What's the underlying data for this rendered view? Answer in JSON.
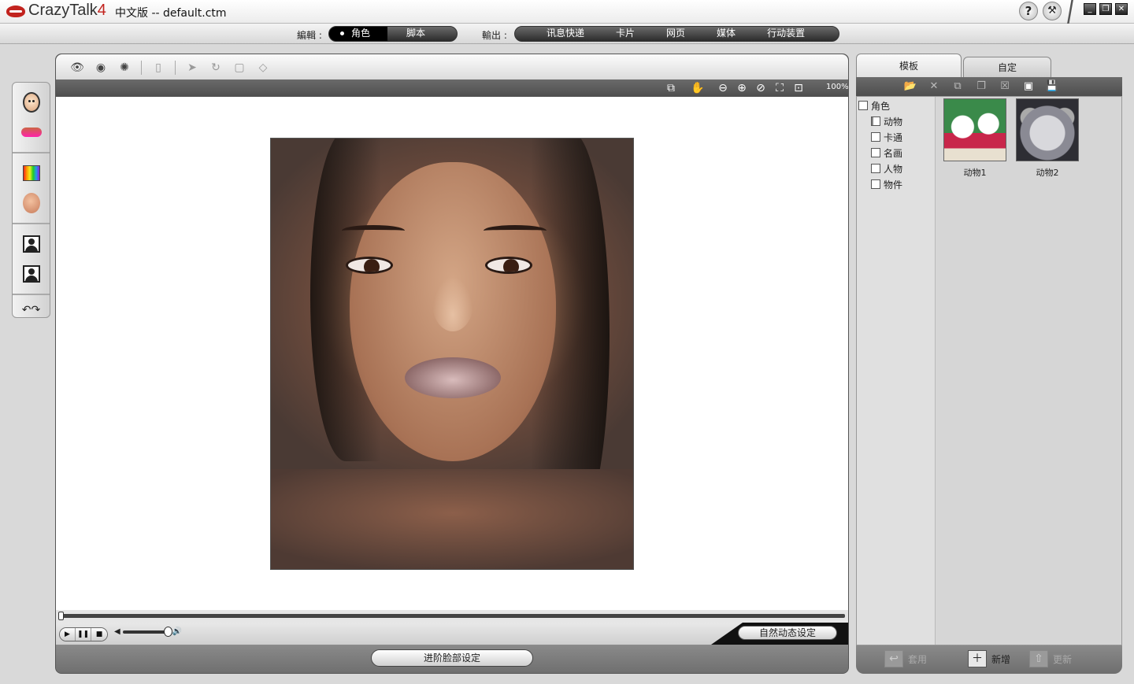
{
  "titlebar": {
    "brand": "CrazyTalk",
    "brand_version": "4",
    "subtitle": "中文版 -- default.ctm",
    "help_icon": "question-mark-icon",
    "tool_icon": "wand-icon",
    "win_minimize": "_",
    "win_restore": "❐",
    "win_close": "✕"
  },
  "modebar": {
    "edit_label": "編輯 :",
    "edit_tabs": [
      {
        "label": "角色",
        "active": true
      },
      {
        "label": "脚本",
        "active": false
      }
    ],
    "output_label": "輸出 :",
    "output_tabs": [
      {
        "label": "讯息快递"
      },
      {
        "label": "卡片"
      },
      {
        "label": "网页"
      },
      {
        "label": "媒体"
      },
      {
        "label": "行动装置"
      }
    ]
  },
  "editor": {
    "zoom": "100%",
    "auto_motion_button": "自然动态设定",
    "advanced_face_button": "进阶脸部设定",
    "transport": {
      "play": "▶",
      "pause": "❚❚",
      "stop": "■"
    },
    "volume_fraction": 0.95
  },
  "right_panel": {
    "tabs": [
      {
        "label": "模板",
        "active": true
      },
      {
        "label": "自定",
        "active": false
      }
    ],
    "tree": {
      "root": "角色",
      "children": [
        "动物",
        "卡通",
        "名画",
        "人物",
        "物件"
      ],
      "selected": "动物"
    },
    "thumbnails": [
      {
        "label": "动物1"
      },
      {
        "label": "动物2"
      }
    ],
    "bottom": {
      "apply": "套用",
      "add": "新增",
      "update": "更新"
    }
  },
  "colors": {
    "brand_red": "#c2231e",
    "toolbar_dark": "#4e4e4e",
    "canvas": "#ffffff"
  }
}
